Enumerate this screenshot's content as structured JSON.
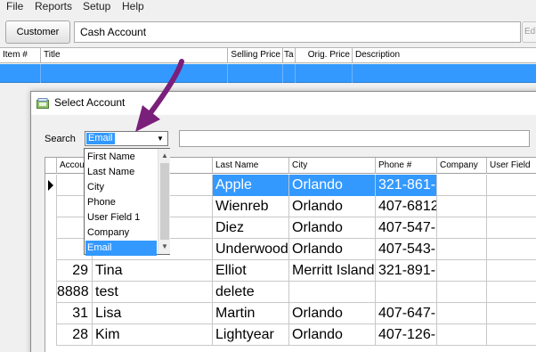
{
  "menu": [
    "File",
    "Reports",
    "Setup",
    "Help"
  ],
  "toolbar": {
    "customer_button": "Customer",
    "account_value": "Cash Account",
    "edit_button": "Edi"
  },
  "items_columns": [
    "Item #",
    "Title",
    "Selling Price",
    "Ta",
    "Orig. Price",
    "Description"
  ],
  "dialog": {
    "title": "Select Account",
    "search_label": "Search",
    "search_field_selected": "Email",
    "search_input_value": "",
    "columns": [
      "Accou",
      "",
      "Last Name",
      "City",
      "Phone #",
      "Company",
      "User Field"
    ],
    "rows": [
      {
        "account": "",
        "first": "",
        "last": "Apple",
        "city": "Orlando",
        "phone": "321-861-",
        "company": "",
        "user_field": "",
        "selected": true
      },
      {
        "account": "",
        "first": "",
        "last": "Wienreb",
        "city": "Orlando",
        "phone": "407-6812",
        "company": "",
        "user_field": ""
      },
      {
        "account": "",
        "first": "",
        "last": "Diez",
        "city": "Orlando",
        "phone": "407-547-",
        "company": "",
        "user_field": ""
      },
      {
        "account": "",
        "first": "",
        "last": "Underwood",
        "city": "Orlando",
        "phone": "407-543-",
        "company": "",
        "user_field": ""
      },
      {
        "account": "29",
        "first": "Tina",
        "last": "Elliot",
        "city": "Merritt Island",
        "phone": "321-891-",
        "company": "",
        "user_field": ""
      },
      {
        "account": "8888",
        "first": "test",
        "last": "delete",
        "city": "",
        "phone": "",
        "company": "",
        "user_field": ""
      },
      {
        "account": "31",
        "first": "Lisa",
        "last": "Martin",
        "city": "Orlando",
        "phone": "407-647-",
        "company": "",
        "user_field": ""
      },
      {
        "account": "28",
        "first": "Kim",
        "last": "Lightyear",
        "city": "Orlando",
        "phone": "407-126-",
        "company": "",
        "user_field": ""
      }
    ],
    "dropdown_options": [
      "First Name",
      "Last Name",
      "City",
      "Phone",
      "User Field 1",
      "Company",
      "Email"
    ],
    "dropdown_active": "Email"
  },
  "annotation": {
    "arrow_color": "#7a1f7a"
  },
  "colors": {
    "selection": "#3399ff"
  }
}
